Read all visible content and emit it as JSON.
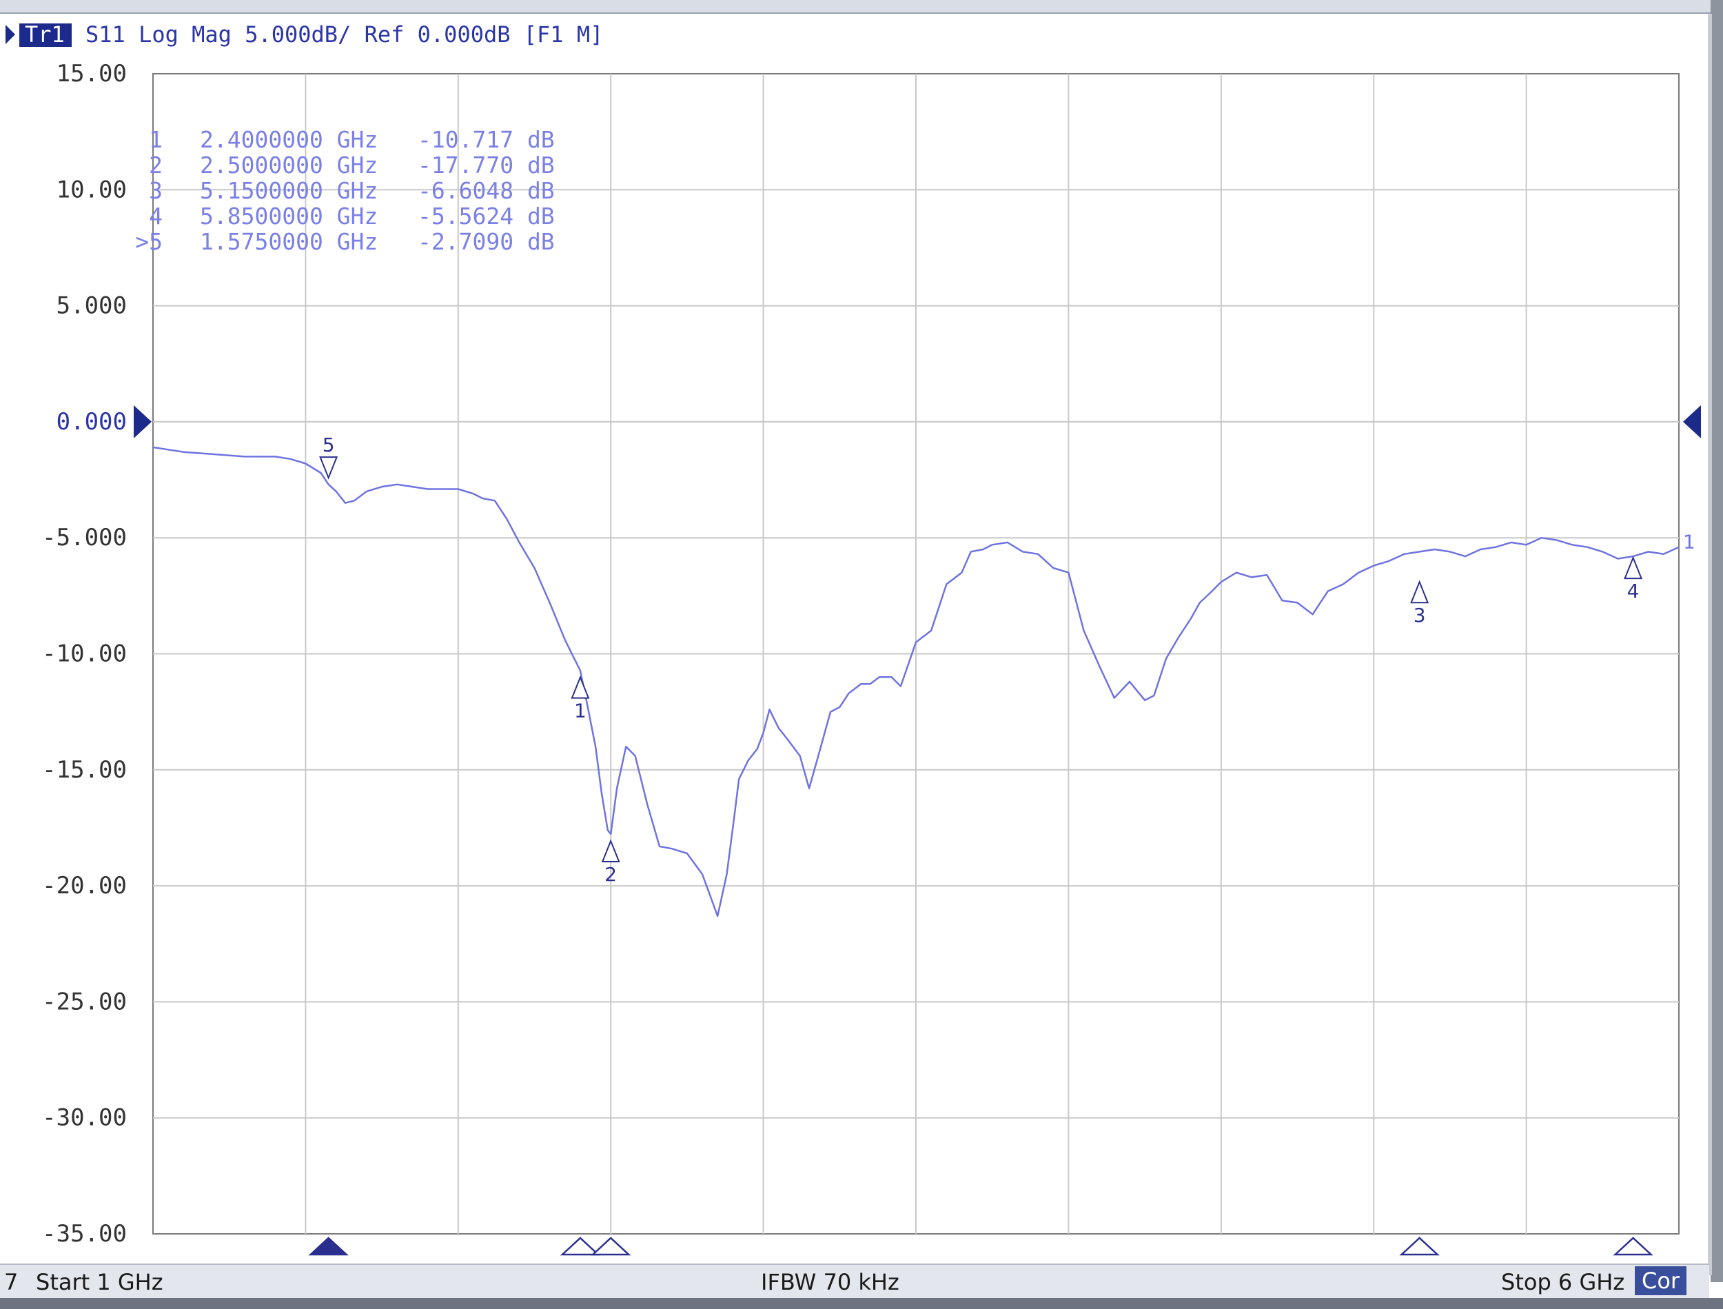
{
  "trace_header": {
    "trace_id": "Tr1",
    "parts": [
      "S11",
      "Log Mag",
      "5.000dB/",
      "Ref",
      "0.000dB",
      "[F1 M]"
    ]
  },
  "status_bar": {
    "channel": "7",
    "start": "Start 1 GHz",
    "ifbw": "IFBW 70 kHz",
    "stop": "Stop 6 GHz",
    "correction": "Cor"
  },
  "colors": {
    "trace": "#6f73e0",
    "marker": "#2a2f8f",
    "grid": "#c8c8c8",
    "axis_text": "#333333",
    "ref_arrow": "#1c2a8c"
  },
  "chart_data": {
    "type": "line",
    "xlim": [
      1.0,
      6.0
    ],
    "ylim": [
      -35,
      15
    ],
    "x_divisions": 10,
    "y_ticks": [
      {
        "value": 15,
        "label": "15.00"
      },
      {
        "value": 10,
        "label": "10.00"
      },
      {
        "value": 5,
        "label": "5.000"
      },
      {
        "value": 0,
        "label": "0.000"
      },
      {
        "value": -5,
        "label": "-5.000"
      },
      {
        "value": -10,
        "label": "-10.00"
      },
      {
        "value": -15,
        "label": "-15.00"
      },
      {
        "value": -20,
        "label": "-20.00"
      },
      {
        "value": -25,
        "label": "-25.00"
      },
      {
        "value": -30,
        "label": "-30.00"
      },
      {
        "value": -35,
        "label": "-35.00"
      }
    ],
    "reference_level": 0,
    "trace_end_label": "1",
    "series": [
      {
        "x": [
          1.0,
          1.05,
          1.1,
          1.2,
          1.3,
          1.35,
          1.4,
          1.45,
          1.5,
          1.55,
          1.575,
          1.6,
          1.63,
          1.66,
          1.7,
          1.75,
          1.8,
          1.85,
          1.9,
          1.95,
          2.0,
          2.05,
          2.08,
          2.12,
          2.16,
          2.2,
          2.25,
          2.3,
          2.35,
          2.38,
          2.4,
          2.42,
          2.45,
          2.47,
          2.49,
          2.5,
          2.52,
          2.55,
          2.58,
          2.62,
          2.66,
          2.7,
          2.75,
          2.8,
          2.85,
          2.88,
          2.9,
          2.92,
          2.95,
          2.98,
          3.0,
          3.02,
          3.05,
          3.08,
          3.12,
          3.15,
          3.18,
          3.22,
          3.25,
          3.28,
          3.32,
          3.35,
          3.38,
          3.42,
          3.45,
          3.5,
          3.55,
          3.6,
          3.65,
          3.68,
          3.72,
          3.75,
          3.8,
          3.85,
          3.9,
          3.95,
          4.0,
          4.05,
          4.1,
          4.15,
          4.2,
          4.25,
          4.28,
          4.32,
          4.36,
          4.4,
          4.43,
          4.47,
          4.5,
          4.55,
          4.6,
          4.65,
          4.7,
          4.75,
          4.8,
          4.85,
          4.9,
          4.95,
          5.0,
          5.05,
          5.1,
          5.15,
          5.2,
          5.25,
          5.3,
          5.35,
          5.4,
          5.45,
          5.5,
          5.55,
          5.6,
          5.65,
          5.7,
          5.75,
          5.8,
          5.85,
          5.9,
          5.95,
          6.0
        ],
        "y": [
          -1.1,
          -1.2,
          -1.3,
          -1.4,
          -1.5,
          -1.5,
          -1.5,
          -1.6,
          -1.8,
          -2.2,
          -2.7,
          -3.0,
          -3.5,
          -3.4,
          -3.0,
          -2.8,
          -2.7,
          -2.8,
          -2.9,
          -2.9,
          -2.9,
          -3.1,
          -3.3,
          -3.4,
          -4.2,
          -5.2,
          -6.3,
          -7.8,
          -9.4,
          -10.2,
          -10.72,
          -12.0,
          -14.0,
          -16.0,
          -17.6,
          -17.77,
          -15.8,
          -14.0,
          -14.4,
          -16.5,
          -18.3,
          -18.4,
          -18.6,
          -19.5,
          -21.3,
          -19.5,
          -17.5,
          -15.4,
          -14.6,
          -14.1,
          -13.4,
          -12.4,
          -13.2,
          -13.7,
          -14.4,
          -15.8,
          -14.4,
          -12.5,
          -12.3,
          -11.7,
          -11.3,
          -11.3,
          -11.0,
          -11.0,
          -11.4,
          -9.5,
          -9.0,
          -7.0,
          -6.5,
          -5.6,
          -5.5,
          -5.3,
          -5.2,
          -5.6,
          -5.7,
          -6.3,
          -6.5,
          -9.0,
          -10.5,
          -11.9,
          -11.2,
          -12.0,
          -11.8,
          -10.2,
          -9.3,
          -8.5,
          -7.8,
          -7.3,
          -6.9,
          -6.5,
          -6.7,
          -6.6,
          -7.7,
          -7.8,
          -8.3,
          -7.3,
          -7.0,
          -6.5,
          -6.2,
          -6.0,
          -5.7,
          -5.6,
          -5.5,
          -5.6,
          -5.8,
          -5.5,
          -5.4,
          -5.2,
          -5.3,
          -5.0,
          -5.1,
          -5.3,
          -5.4,
          -5.6,
          -5.9,
          -5.8,
          -5.6,
          -5.7,
          -5.4
        ]
      }
    ],
    "markers": [
      {
        "id": "1",
        "x": 2.4,
        "y": -10.717,
        "freq_label": "2.4000000 GHz",
        "val_label": "-10.717 dB",
        "row_prefix": "1"
      },
      {
        "id": "2",
        "x": 2.5,
        "y": -17.77,
        "freq_label": "2.5000000 GHz",
        "val_label": "-17.770 dB",
        "row_prefix": "2"
      },
      {
        "id": "3",
        "x": 5.15,
        "y": -6.6048,
        "freq_label": "5.1500000 GHz",
        "val_label": "-6.6048 dB",
        "row_prefix": "3"
      },
      {
        "id": "4",
        "x": 5.85,
        "y": -5.5624,
        "freq_label": "5.8500000 GHz",
        "val_label": "-5.5624 dB",
        "row_prefix": "4"
      },
      {
        "id": "5",
        "x": 1.575,
        "y": -2.709,
        "freq_label": "1.5750000 GHz",
        "val_label": "-2.7090 dB",
        "row_prefix": ">5",
        "active": true
      }
    ]
  }
}
